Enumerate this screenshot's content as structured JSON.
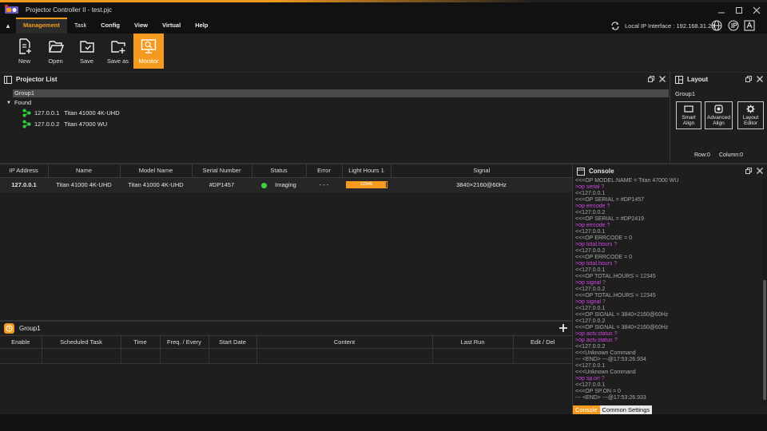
{
  "window": {
    "title": "Projector Controller II - test.pjc",
    "controls": [
      "minimize-icon",
      "maximize-icon",
      "close-icon"
    ]
  },
  "menu": {
    "collapse_icon": "caret-up-icon",
    "items": [
      "Management",
      "Task",
      "Config",
      "View",
      "Virtual",
      "Help"
    ],
    "active": "Management",
    "ip_label": "Local IP Interface : 192.168.31.23",
    "right_icons": [
      "refresh-icon",
      "globe-icon",
      "translate-icon"
    ]
  },
  "ribbon": {
    "buttons": [
      {
        "label": "New",
        "icon": "new-file-icon"
      },
      {
        "label": "Open",
        "icon": "folder-open-icon"
      },
      {
        "label": "Save",
        "icon": "save-folder-icon"
      },
      {
        "label": "Save as",
        "icon": "save-as-folder-icon"
      },
      {
        "label": "Monitor",
        "icon": "monitor-icon",
        "active": true
      }
    ]
  },
  "projector_list": {
    "title": "Projector List",
    "group": "Group1",
    "found_label": "Found",
    "items": [
      {
        "ip": "127.0.0.1",
        "model": "Titan 41000 4K-UHD"
      },
      {
        "ip": "127.0.0.2",
        "model": "Titan 47000 WU"
      }
    ]
  },
  "layout_panel": {
    "title": "Layout",
    "group": "Group1",
    "buttons": [
      {
        "label": "Smart\nAlign",
        "icon": "smart-align-icon"
      },
      {
        "label": "Advanced\nAlign",
        "icon": "advanced-align-icon"
      },
      {
        "label": "Layout\nEditor",
        "icon": "gear-icon"
      }
    ],
    "row_label": "Row:0",
    "column_label": "Column:0"
  },
  "status_table": {
    "headers": [
      "IP Address",
      "Name",
      "Model Name",
      "Serial Number",
      "Status",
      "Error",
      "Light Hours 1",
      "Signal"
    ],
    "rows": [
      {
        "ip": "127.0.0.1",
        "name": "Titan 41000 4K-UHD",
        "model": "Titan 41000 4K-UHD",
        "serial": "#DP1457",
        "status": "Imaging",
        "error": "- - -",
        "light_hours": "12345",
        "light_hours_fraction": 0.98,
        "signal": "3840×2160@60Hz"
      }
    ],
    "status_color": "#3fd13f"
  },
  "schedule": {
    "group": "Group1",
    "headers": [
      "Enable",
      "Scheduled Task",
      "Time",
      "Freq. / Every",
      "Start Date",
      "Content",
      "Last Run",
      "Edit / Del"
    ]
  },
  "console": {
    "title": "Console",
    "lines": [
      {
        "t": "<<<OP MODEL.NAME = Titan 47000 WU",
        "c": "g"
      },
      {
        "t": ">op serial ?",
        "c": "m"
      },
      {
        "t": "<<127.0.0.1",
        "c": "g"
      },
      {
        "t": "<<<OP SERIAL = #DP1457",
        "c": "g"
      },
      {
        "t": ">op errcode ?",
        "c": "m"
      },
      {
        "t": "<<127.0.0.2",
        "c": "g"
      },
      {
        "t": "<<<OP SERIAL = #DP2419",
        "c": "g"
      },
      {
        "t": ">op errcode ?",
        "c": "m"
      },
      {
        "t": "<<127.0.0.1",
        "c": "g"
      },
      {
        "t": "<<<OP ERRCODE = 0",
        "c": "g"
      },
      {
        "t": ">op total.hours ?",
        "c": "m"
      },
      {
        "t": "<<127.0.0.2",
        "c": "g"
      },
      {
        "t": "<<<OP ERRCODE = 0",
        "c": "g"
      },
      {
        "t": ">op total.hours ?",
        "c": "m"
      },
      {
        "t": "<<127.0.0.1",
        "c": "g"
      },
      {
        "t": "<<<OP TOTAL.HOURS = 12345",
        "c": "g"
      },
      {
        "t": ">op signal ?",
        "c": "m"
      },
      {
        "t": "<<127.0.0.2",
        "c": "g"
      },
      {
        "t": "<<<OP TOTAL.HOURS = 12345",
        "c": "g"
      },
      {
        "t": ">op signal ?",
        "c": "m"
      },
      {
        "t": "<<127.0.0.1",
        "c": "g"
      },
      {
        "t": "<<<OP SIGNAL = 3840×2160@60Hz",
        "c": "g"
      },
      {
        "t": "<<127.0.0.2",
        "c": "g"
      },
      {
        "t": "<<<OP SIGNAL = 3840×2160@60Hz",
        "c": "g"
      },
      {
        "t": ">op actv.status ?",
        "c": "m"
      },
      {
        "t": ">op actv.status ?",
        "c": "m"
      },
      {
        "t": "<<127.0.0.2",
        "c": "g"
      },
      {
        "t": "<<<Unknown Command",
        "c": "g"
      },
      {
        "t": "--- <END> ---@17:53:26.934",
        "c": "g"
      },
      {
        "t": "<<127.0.0.1",
        "c": "g"
      },
      {
        "t": "<<<Unknown Command",
        "c": "g"
      },
      {
        "t": ">op sp.on ?",
        "c": "m"
      },
      {
        "t": "<<127.0.0.1",
        "c": "g"
      },
      {
        "t": "<<<OP SP.ON = 0",
        "c": "g"
      },
      {
        "t": "--- <END> ---@17:53:26.933",
        "c": "g"
      }
    ],
    "tabs": [
      "Console",
      "Common Settings"
    ],
    "active_tab": "Console"
  },
  "colors": {
    "accent": "#f39a1f",
    "magenta": "#d146e0",
    "console_text": "#a9a9a9"
  }
}
